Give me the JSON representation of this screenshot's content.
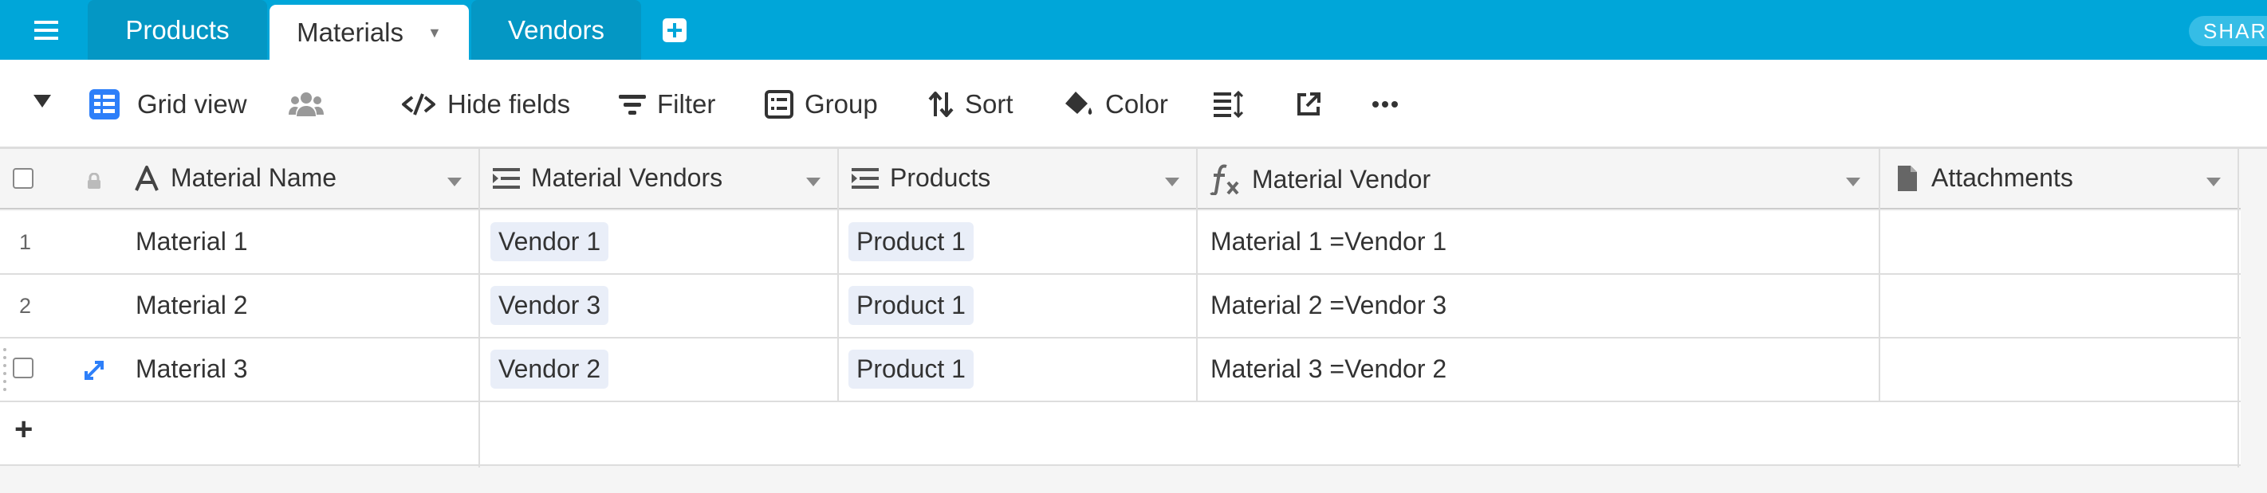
{
  "topbar": {
    "tabs": [
      {
        "label": "Products"
      },
      {
        "label": "Materials"
      },
      {
        "label": "Vendors"
      }
    ],
    "share_label": "SHAR"
  },
  "toolbar": {
    "view_name": "Grid view",
    "hide_fields": "Hide fields",
    "filter": "Filter",
    "group": "Group",
    "sort": "Sort",
    "color": "Color"
  },
  "columns": [
    {
      "label": "Material Name"
    },
    {
      "label": "Material Vendors"
    },
    {
      "label": "Products"
    },
    {
      "label": "Material Vendor"
    },
    {
      "label": "Attachments"
    }
  ],
  "rows": [
    {
      "num": "1",
      "name": "Material 1",
      "vendor": "Vendor 1",
      "product": "Product 1",
      "formula": "Material 1 =Vendor 1",
      "attachments": ""
    },
    {
      "num": "2",
      "name": "Material 2",
      "vendor": "Vendor 3",
      "product": "Product 1",
      "formula": "Material 2 =Vendor 3",
      "attachments": ""
    },
    {
      "num": "",
      "name": "Material 3",
      "vendor": "Vendor 2",
      "product": "Product 1",
      "formula": "Material 3 =Vendor 2",
      "attachments": ""
    }
  ],
  "add_row_symbol": "+",
  "colors": {
    "topbar": "#00a6d9",
    "tab_inactive": "#0497c4",
    "pill": "#e9eef8",
    "accent_blue": "#2d7ff9"
  }
}
